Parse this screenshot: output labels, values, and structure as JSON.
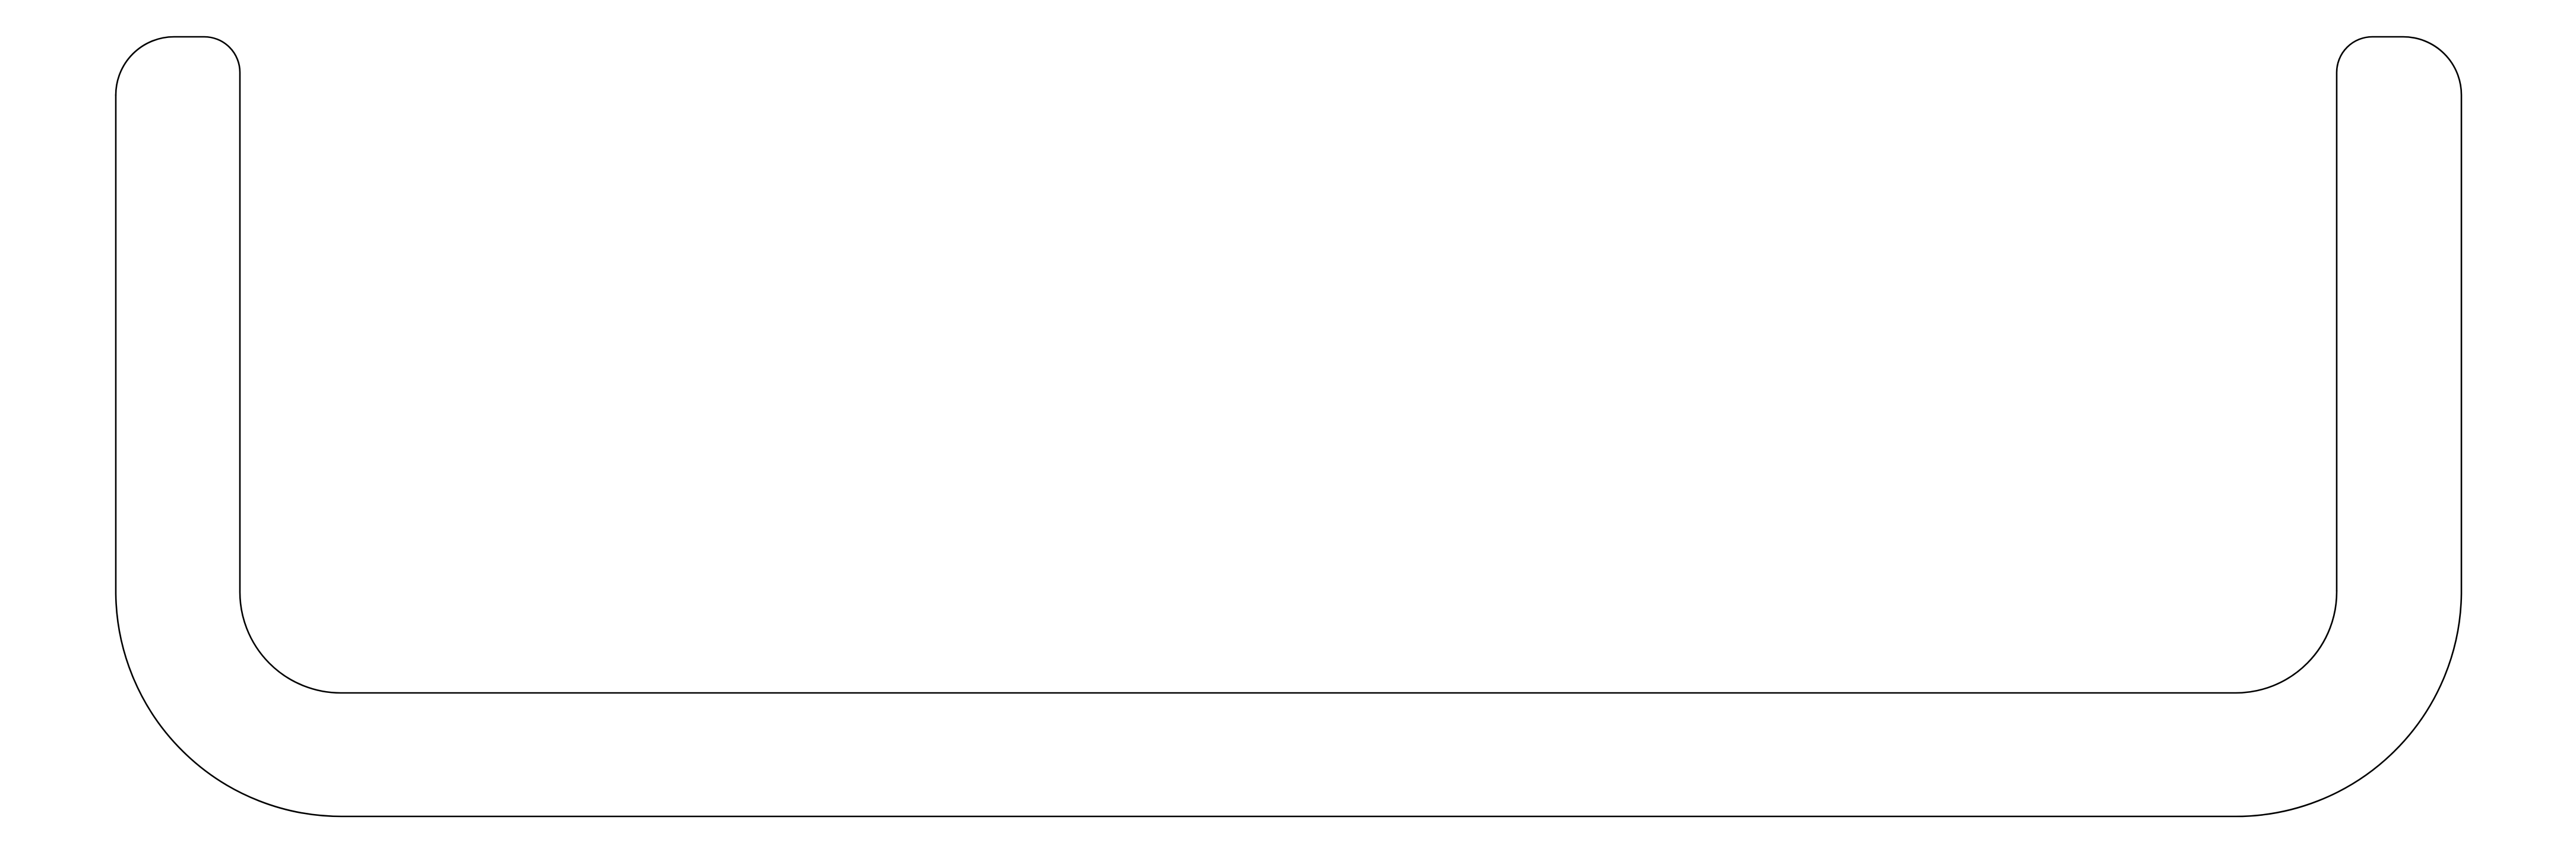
{
  "drawing": {
    "shape": "u-shaped-bent-bar-outline",
    "stroke_color": "#000000",
    "background_color": "#ffffff"
  }
}
